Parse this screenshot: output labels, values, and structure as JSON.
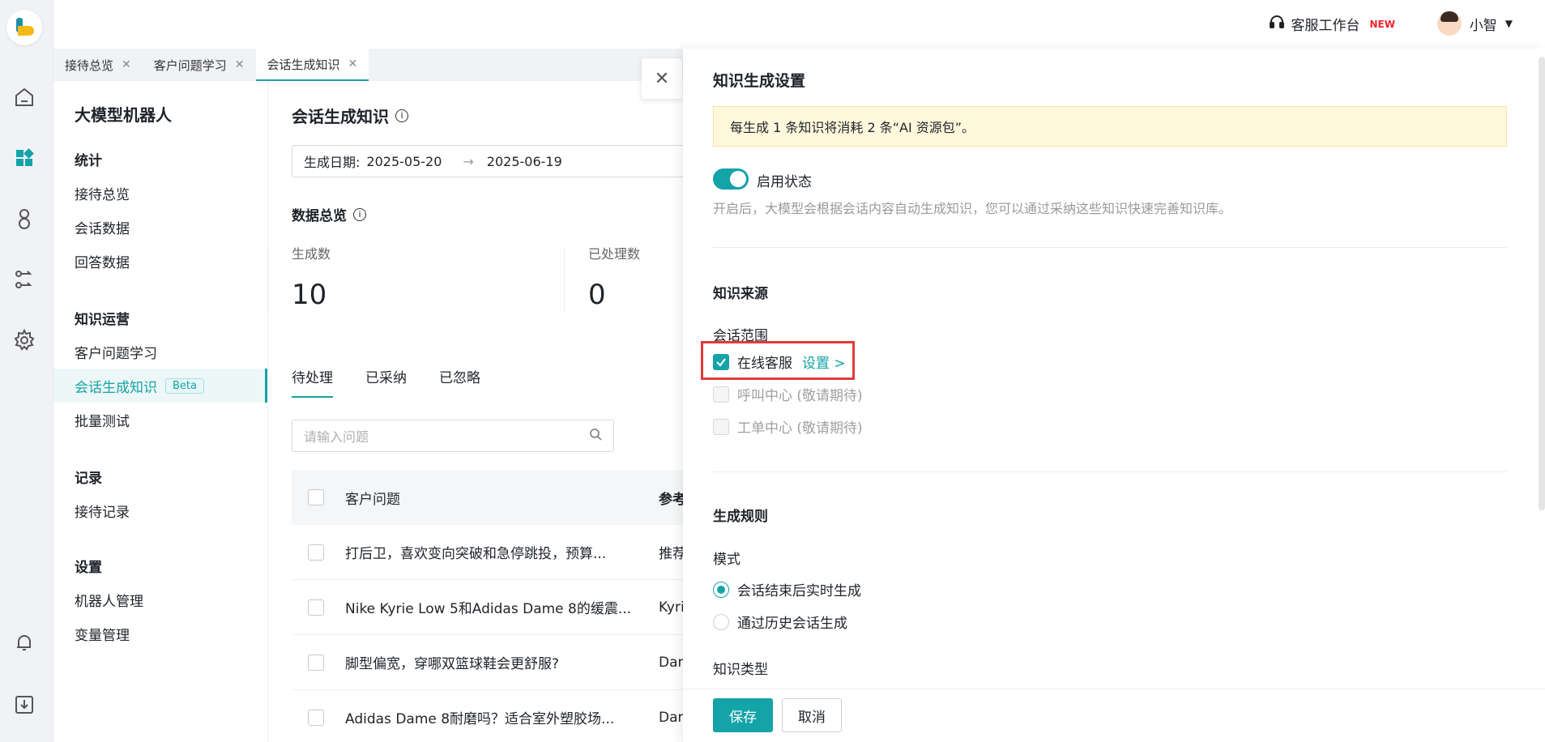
{
  "topbar": {
    "workspace_label": "客服工作台",
    "workspace_badge": "NEW",
    "user_name": "小智"
  },
  "tabs": [
    {
      "label": "接待总览"
    },
    {
      "label": "客户问题学习"
    },
    {
      "label": "会话生成知识"
    }
  ],
  "sidebar": {
    "title": "大模型机器人",
    "groups": [
      {
        "title": "统计",
        "items": [
          "接待总览",
          "会话数据",
          "回答数据"
        ]
      },
      {
        "title": "知识运营",
        "items": [
          "客户问题学习",
          "会话生成知识",
          "批量测试"
        ]
      },
      {
        "title": "记录",
        "items": [
          "接待记录"
        ]
      },
      {
        "title": "设置",
        "items": [
          "机器人管理",
          "变量管理"
        ]
      }
    ],
    "beta_label": "Beta"
  },
  "main": {
    "title": "会话生成知识",
    "date_label": "生成日期:",
    "date_start": "2025-05-20",
    "date_end": "2025-06-19",
    "overview_title": "数据总览",
    "stats": [
      {
        "label": "生成数",
        "value": "10"
      },
      {
        "label": "已处理数",
        "value": "0"
      }
    ],
    "subtabs": [
      "待处理",
      "已采纳",
      "已忽略"
    ],
    "search_placeholder": "请输入问题",
    "table_headers": [
      "客户问题",
      "参考"
    ],
    "rows": [
      {
        "question": "打后卫，喜欢变向突破和急停跳投，预算...",
        "ref": "推荐"
      },
      {
        "question": "Nike Kyrie Low 5和Adidas Dame 8的缓震...",
        "ref": "Kyrie"
      },
      {
        "question": "脚型偏宽，穿哪双篮球鞋会更舒服?",
        "ref": "Dam"
      },
      {
        "question": "Adidas Dame 8耐磨吗？适合室外塑胶场...",
        "ref": "Dam"
      }
    ]
  },
  "drawer": {
    "title": "知识生成设置",
    "notice": "每生成 1 条知识将消耗 2 条“AI 资源包”。",
    "toggle_label": "启用状态",
    "toggle_on": true,
    "hint": "开启后，大模型会根据会话内容自动生成知识，您可以通过采纳这些知识快速完善知识库。",
    "source_title": "知识来源",
    "scope_label": "会话范围",
    "scope_options": [
      {
        "label": "在线客服",
        "checked": true,
        "disabled": false,
        "link": "设置 >"
      },
      {
        "label": "呼叫中心 (敬请期待)",
        "checked": false,
        "disabled": true
      },
      {
        "label": "工单中心 (敬请期待)",
        "checked": false,
        "disabled": true
      }
    ],
    "rule_title": "生成规则",
    "mode_label": "模式",
    "mode_options": [
      {
        "label": "会话结束后实时生成",
        "selected": true
      },
      {
        "label": "通过历史会话生成",
        "selected": false
      }
    ],
    "type_label": "知识类型",
    "save_label": "保存",
    "cancel_label": "取消"
  },
  "colors": {
    "accent": "#14a3a8",
    "highlight_box": "#e23a3a",
    "notice_bg": "#fff8dc"
  }
}
